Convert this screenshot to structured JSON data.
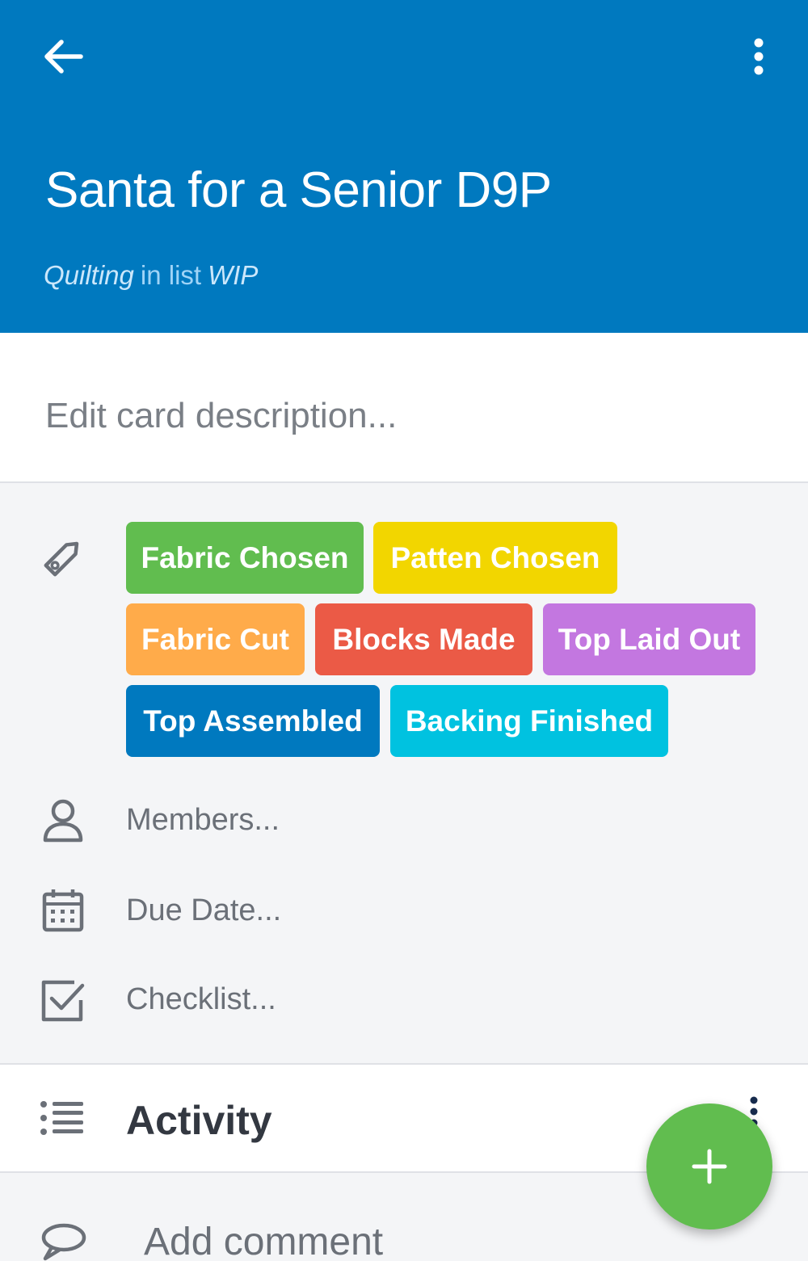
{
  "header": {
    "title": "Santa for a Senior D9P",
    "board_name": "Quilting",
    "separator": "in list",
    "list_name": "WIP",
    "back_icon": "arrow-left-icon",
    "menu_icon": "more-vertical-icon",
    "color": "#0079bf"
  },
  "description": {
    "placeholder": "Edit card description..."
  },
  "labels": {
    "icon": "tag-icon",
    "items": [
      {
        "text": "Fabric Chosen",
        "color": "#61bd4f"
      },
      {
        "text": "Patten Chosen",
        "color": "#f2d600"
      },
      {
        "text": "Fabric Cut",
        "color": "#ffab4a"
      },
      {
        "text": "Blocks Made",
        "color": "#eb5a46"
      },
      {
        "text": "Top Laid Out",
        "color": "#c377e0"
      },
      {
        "text": "Top Assembled",
        "color": "#0079bf"
      },
      {
        "text": "Backing Finished",
        "color": "#00c2e0"
      }
    ]
  },
  "fields": {
    "members": "Members...",
    "due_date": "Due Date...",
    "checklist": "Checklist..."
  },
  "activity": {
    "title": "Activity",
    "add_comment": "Add comment"
  },
  "fab": {
    "icon": "plus-icon",
    "color": "#61bd4f"
  }
}
